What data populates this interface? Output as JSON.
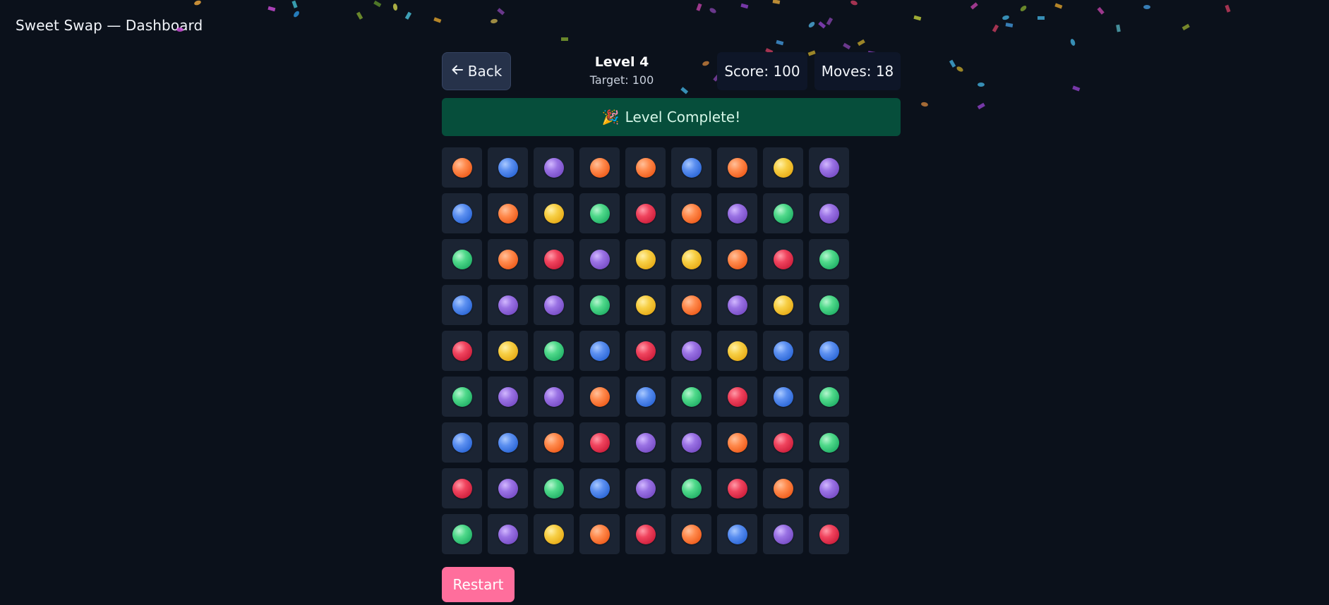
{
  "app": {
    "title": "Sweet Swap — Dashboard"
  },
  "header": {
    "back_label": "Back",
    "back_icon": "arrow-left-icon",
    "level_title": "Level 4",
    "target_text": "Target: 100",
    "score_text": "Score: 100",
    "moves_text": "Moves: 18"
  },
  "banner": {
    "icon": "party-popper-icon",
    "icon_glyph": "🎉",
    "text": "Level Complete!"
  },
  "board": {
    "rows": 9,
    "cols": 9,
    "cells": [
      [
        "orange",
        "blue",
        "purple",
        "orange",
        "orange",
        "blue",
        "orange",
        "yellow",
        "purple"
      ],
      [
        "blue",
        "orange",
        "yellow",
        "green",
        "red",
        "orange",
        "purple",
        "green",
        "purple"
      ],
      [
        "green",
        "orange",
        "red",
        "purple",
        "yellow",
        "yellow",
        "orange",
        "red",
        "green"
      ],
      [
        "blue",
        "purple",
        "purple",
        "green",
        "yellow",
        "orange",
        "purple",
        "yellow",
        "green"
      ],
      [
        "red",
        "yellow",
        "green",
        "blue",
        "red",
        "purple",
        "yellow",
        "blue",
        "blue"
      ],
      [
        "green",
        "purple",
        "purple",
        "orange",
        "blue",
        "green",
        "red",
        "blue",
        "green"
      ],
      [
        "blue",
        "blue",
        "orange",
        "red",
        "purple",
        "purple",
        "orange",
        "red",
        "green"
      ],
      [
        "red",
        "purple",
        "green",
        "blue",
        "purple",
        "green",
        "red",
        "orange",
        "purple"
      ],
      [
        "green",
        "purple",
        "yellow",
        "orange",
        "red",
        "orange",
        "blue",
        "purple",
        "red"
      ]
    ]
  },
  "footer": {
    "restart_label": "Restart"
  },
  "colors": {
    "background": "#0b111b",
    "banner": "#064e3b",
    "restart": "#ff6e9c",
    "cell": "#1b2433",
    "back_button": "#26324a"
  }
}
